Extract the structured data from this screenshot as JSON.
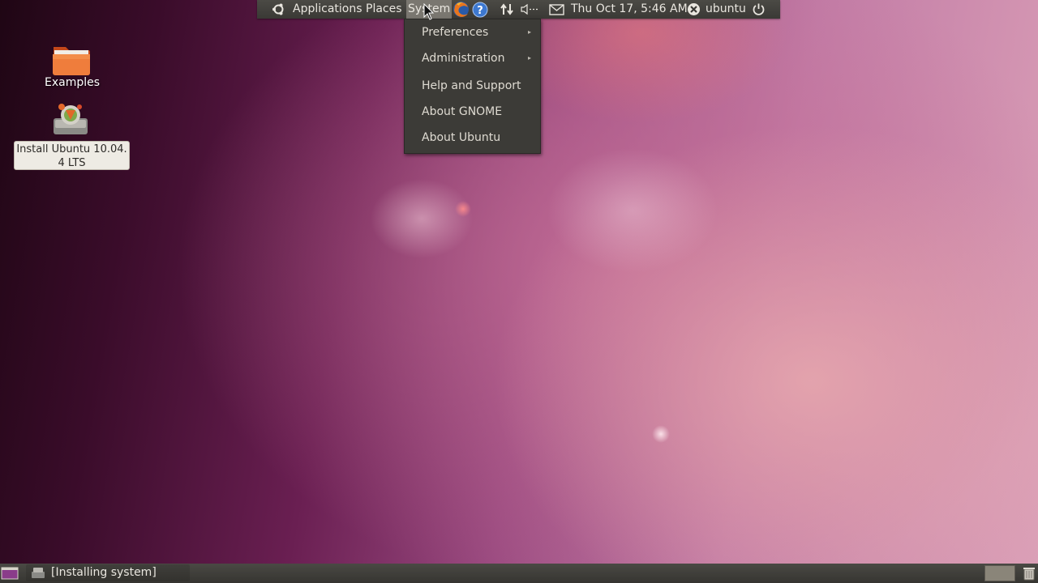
{
  "top_panel": {
    "applications_label": "Applications",
    "places_label": "Places",
    "system_label": "System",
    "clock": "Thu Oct 17,  5:46 AM",
    "user_name": "ubuntu",
    "icons": [
      "ubuntu-logo-icon",
      "firefox-icon",
      "help-icon",
      "network-icon",
      "volume-icon",
      "mail-icon",
      "user-status-icon",
      "power-icon"
    ]
  },
  "system_menu": {
    "items": [
      {
        "label": "Preferences",
        "has_submenu": true
      },
      {
        "label": "Administration",
        "has_submenu": true
      },
      {
        "label": "Help and Support",
        "has_submenu": false
      },
      {
        "label": "About GNOME",
        "has_submenu": false
      },
      {
        "label": "About Ubuntu",
        "has_submenu": false
      }
    ],
    "submenu_arrow": "▸"
  },
  "desktop": {
    "icons": [
      {
        "label": "Examples",
        "icon": "folder-icon"
      },
      {
        "label_line1": "Install Ubuntu 10.04.",
        "label_line2": "4 LTS",
        "icon": "installer-icon",
        "selected": true
      }
    ]
  },
  "bottom_panel": {
    "taskbar_label": "[Installing system]"
  },
  "colors": {
    "panel": "#3c3b37",
    "menu_bg": "#3c3b37",
    "menu_text": "#dfdbd2",
    "selected_menu": "#7a7770",
    "folder": "#e9642f"
  }
}
